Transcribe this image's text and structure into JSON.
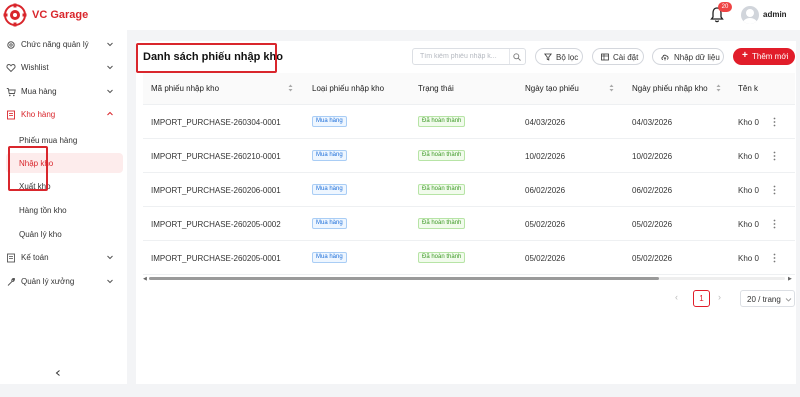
{
  "app": {
    "brand": "VC Garage",
    "notification_count": "20",
    "username": "admin",
    "accent_color": "#d9262c"
  },
  "sidebar": {
    "items": [
      {
        "label": "Chức năng quản lý",
        "icon": "gear-icon",
        "chevron": "down"
      },
      {
        "label": "Wishlist",
        "icon": "heart-icon",
        "chevron": "down"
      },
      {
        "label": "Mua hàng",
        "icon": "cart-icon",
        "chevron": "down"
      },
      {
        "label": "Kho hàng",
        "icon": "warehouse-icon",
        "chevron": "up"
      },
      {
        "label": "Kế toán",
        "icon": "accounting-icon",
        "chevron": "down"
      },
      {
        "label": "Quản lý xưởng",
        "icon": "wrench-icon",
        "chevron": "down"
      }
    ],
    "sub_items": [
      "Phiếu mua hàng",
      "Nhập kho",
      "Xuất kho",
      "Hàng tồn kho",
      "Quản lý kho"
    ],
    "selected_sub": "Nhập kho"
  },
  "page": {
    "title": "Danh sách phiếu nhập kho"
  },
  "toolbar": {
    "search_placeholder": "Tìm kiếm phiếu nhập k...",
    "filter_label": "Bộ lọc",
    "settings_label": "Cài đặt",
    "import_label": "Nhập dữ liệu",
    "add_label": "Thêm mới"
  },
  "table": {
    "columns": [
      "Mã phiếu nhập kho",
      "Loại phiếu nhập kho",
      "Trạng thái",
      "Ngày tạo phiếu",
      "Ngày phiếu nhập kho",
      "Tên k"
    ],
    "rows": [
      {
        "code": "IMPORT_PURCHASE-260304-0001",
        "type": "Mua hàng",
        "status": "Đã hoàn thành",
        "created": "04/03/2026",
        "import_date": "04/03/2026",
        "name": "Kho 0"
      },
      {
        "code": "IMPORT_PURCHASE-260210-0001",
        "type": "Mua hàng",
        "status": "Đã hoàn thành",
        "created": "10/02/2026",
        "import_date": "10/02/2026",
        "name": "Kho 0"
      },
      {
        "code": "IMPORT_PURCHASE-260206-0001",
        "type": "Mua hàng",
        "status": "Đã hoàn thành",
        "created": "06/02/2026",
        "import_date": "06/02/2026",
        "name": "Kho 0"
      },
      {
        "code": "IMPORT_PURCHASE-260205-0002",
        "type": "Mua hàng",
        "status": "Đã hoàn thành",
        "created": "05/02/2026",
        "import_date": "05/02/2026",
        "name": "Kho 0"
      },
      {
        "code": "IMPORT_PURCHASE-260205-0001",
        "type": "Mua hàng",
        "status": "Đã hoàn thành",
        "created": "05/02/2026",
        "import_date": "05/02/2026",
        "name": "Kho 0"
      }
    ]
  },
  "pagination": {
    "current_page": "1",
    "page_size": "20 / trang"
  }
}
